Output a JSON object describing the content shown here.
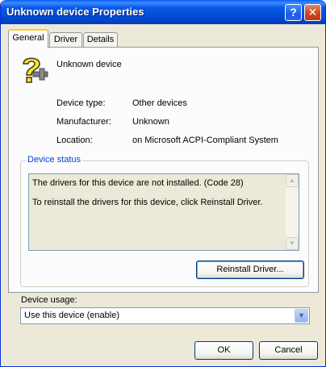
{
  "window": {
    "title": "Unknown device Properties"
  },
  "titlebar": {
    "help_glyph": "?",
    "close_glyph": "✕"
  },
  "tabs": [
    {
      "label": "General",
      "active": true
    },
    {
      "label": "Driver",
      "active": false
    },
    {
      "label": "Details",
      "active": false
    }
  ],
  "device": {
    "icon": "unknown-device-icon",
    "name": "Unknown device"
  },
  "properties": [
    {
      "label": "Device type:",
      "value": "Other devices"
    },
    {
      "label": "Manufacturer:",
      "value": "Unknown"
    },
    {
      "label": "Location:",
      "value": "on Microsoft ACPI-Compliant System"
    }
  ],
  "status": {
    "group_title": "Device status",
    "line1": "The drivers for this device are not installed. (Code 28)",
    "line2": "To reinstall the drivers for this device, click Reinstall Driver.",
    "reinstall_button": "Reinstall Driver..."
  },
  "usage": {
    "label": "Device usage:",
    "selected": "Use this device (enable)"
  },
  "buttons": {
    "ok": "OK",
    "cancel": "Cancel"
  },
  "colors": {
    "titlebar": "#0054e3",
    "group_title": "#0046d5",
    "tab_highlight": "#ffc83c",
    "dialog_bg": "#ece9d8"
  }
}
